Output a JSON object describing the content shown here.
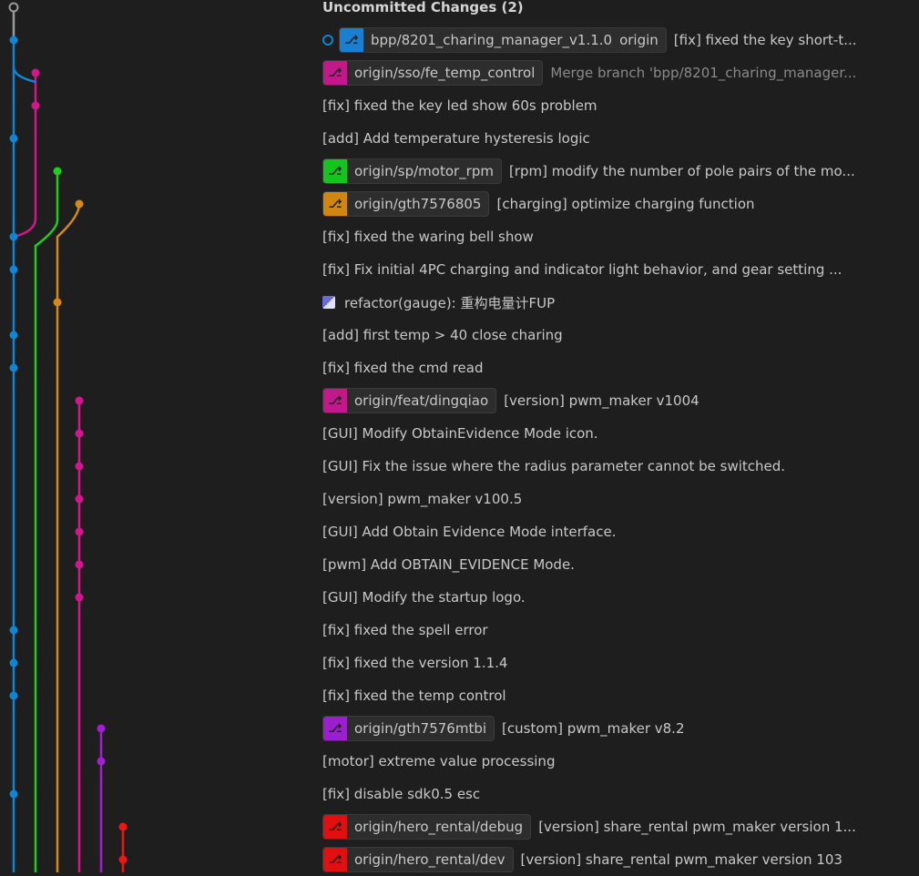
{
  "header": {
    "title": "Uncommitted Changes (2)"
  },
  "commits": [
    {
      "ref": "bpp/8201_charing_manager_v1.1.0",
      "ref2": "origin",
      "ref_color": "#1b7fd1",
      "head": true,
      "message": "[fix] fixed the key short-t...",
      "dim": false
    },
    {
      "ref": "origin/sso/fe_temp_control",
      "ref_color": "#c2188a",
      "message": "Merge branch 'bpp/8201_charing_manager...",
      "dim": true
    },
    {
      "message": "[fix] fixed the key led show 60s problem"
    },
    {
      "message": "[add] Add temperature hysteresis logic"
    },
    {
      "ref": "origin/sp/motor_rpm",
      "ref_color": "#15c41e",
      "message": "[rpm] modify the number of pole pairs of the mo..."
    },
    {
      "ref": "origin/gth7576805",
      "ref_color": "#d1860f",
      "message": "[charging] optimize charging function"
    },
    {
      "message": "[fix] fixed the waring bell show"
    },
    {
      "message": "[fix] Fix initial 4PC charging and indicator light behavior, and gear setting ..."
    },
    {
      "avatar": true,
      "message": "refactor(gauge): 重构电量计FUP"
    },
    {
      "message": "[add] first temp > 40 close charing"
    },
    {
      "message": "[fix] fixed the cmd read"
    },
    {
      "ref": "origin/feat/dingqiao",
      "ref_color": "#c2188a",
      "message": "[version] pwm_maker v1004"
    },
    {
      "message": "[GUI] Modify ObtainEvidence Mode icon."
    },
    {
      "message": "[GUI] Fix the issue where the radius parameter cannot be switched."
    },
    {
      "message": "[version] pwm_maker v100.5"
    },
    {
      "message": "[GUI] Add Obtain Evidence Mode interface."
    },
    {
      "message": "[pwm] Add OBTAIN_EVIDENCE Mode."
    },
    {
      "message": "[GUI] Modify the startup logo."
    },
    {
      "message": "[fix] fixed the spell error"
    },
    {
      "message": "[fix] fixed the version 1.1.4"
    },
    {
      "message": "[fix] fixed the temp control"
    },
    {
      "ref": "origin/gth7576mtbi",
      "ref_color": "#9b1ecf",
      "message": "[custom] pwm_maker v8.2"
    },
    {
      "message": "[motor] extreme value processing"
    },
    {
      "message": "[fix] disable sdk0.5 esc"
    },
    {
      "ref": "origin/hero_rental/debug",
      "ref_color": "#e01010",
      "message": "[version] share_rental pwm_maker version 1..."
    },
    {
      "ref": "origin/hero_rental/dev",
      "ref_color": "#e01010",
      "message": "[version] share_rental pwm_maker version 103"
    }
  ],
  "graph": {
    "colors": {
      "main": "#0e86d4",
      "pink": "#d4158e",
      "green": "#1ecf1e",
      "orange": "#d58a12",
      "purple": "#a31ed6",
      "red": "#f01616",
      "uncommitted": "#9a9a9a"
    }
  }
}
